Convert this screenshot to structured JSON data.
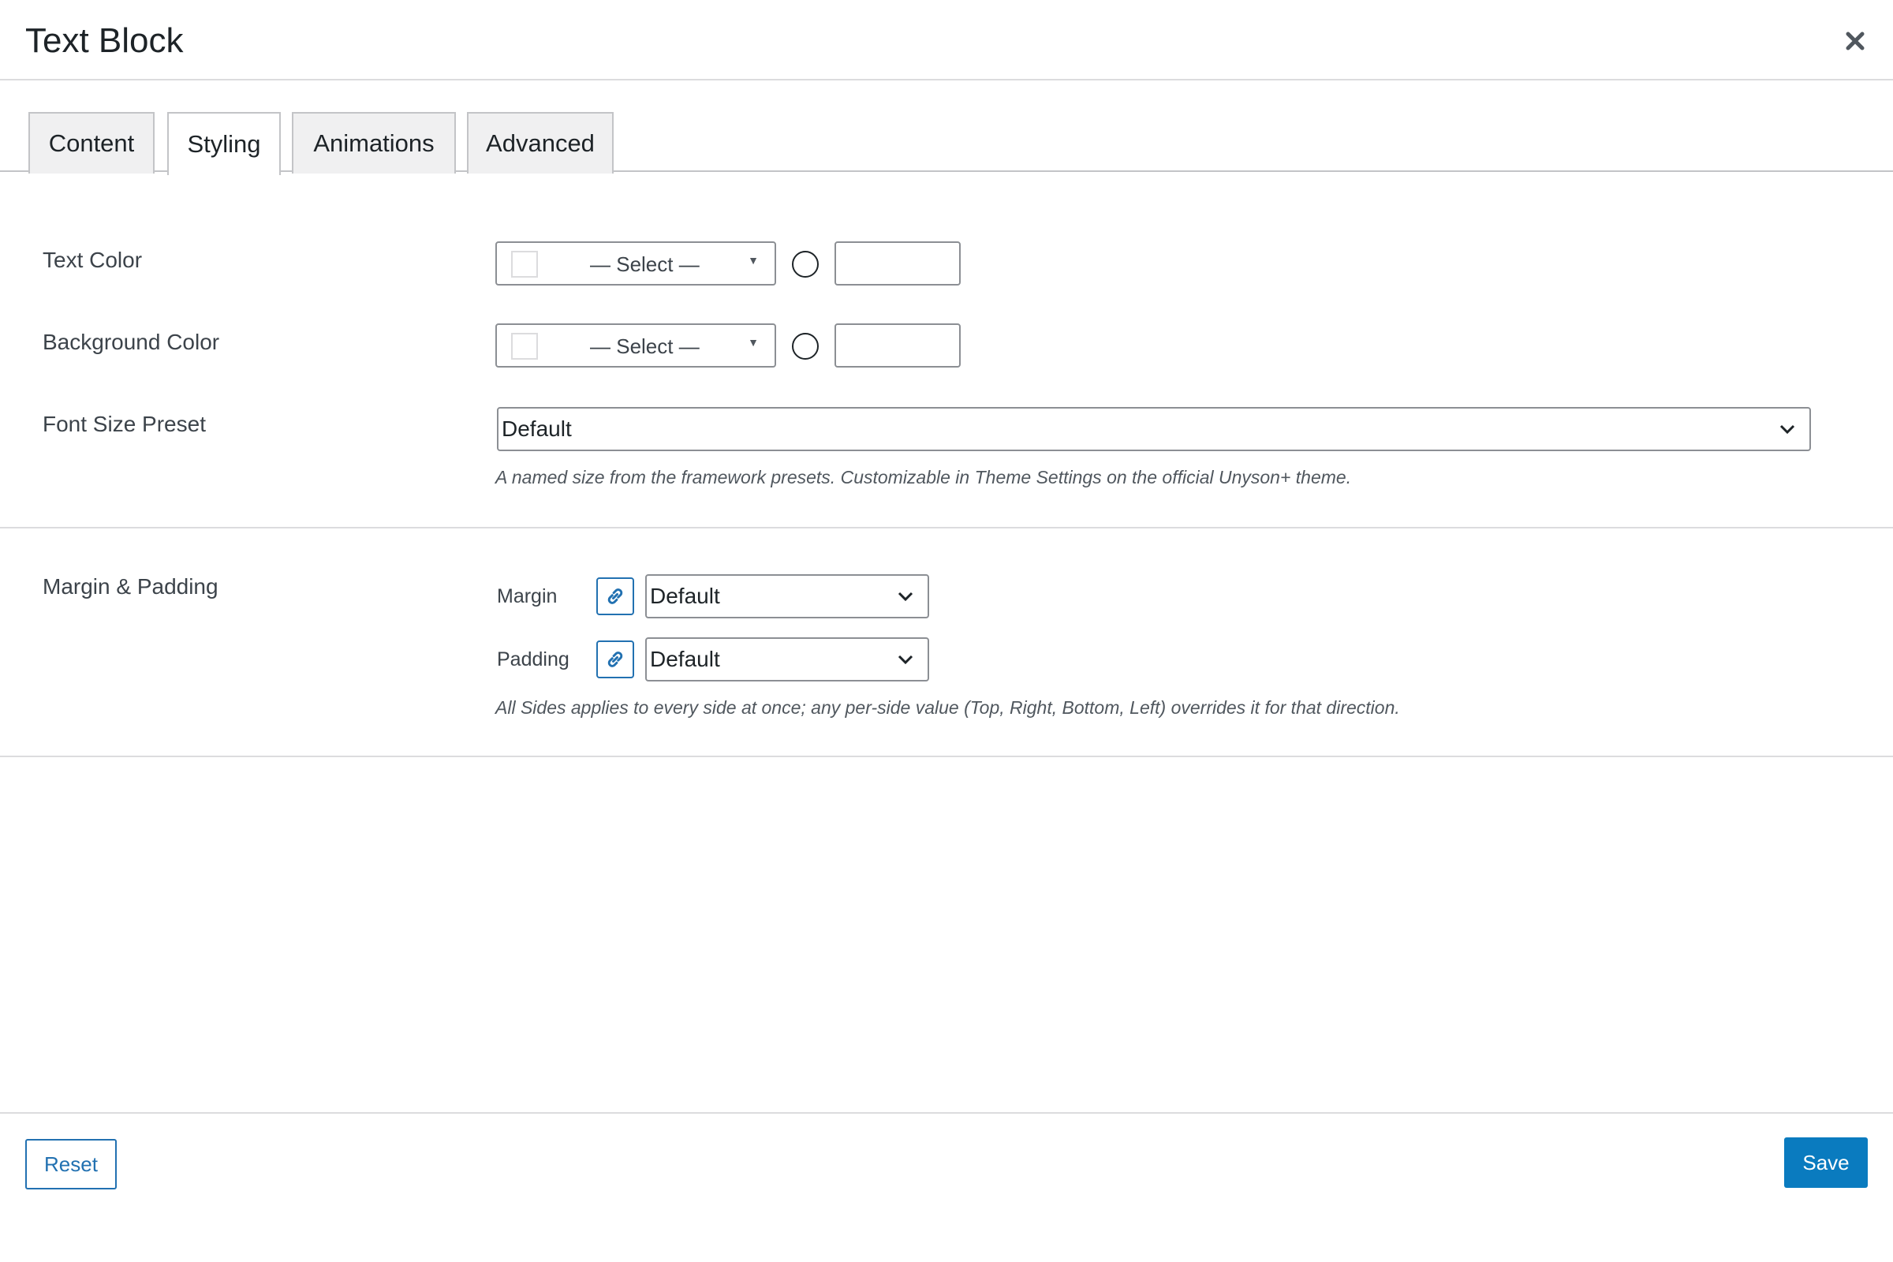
{
  "modal": {
    "title": "Text Block"
  },
  "tabs": [
    {
      "label": "Content",
      "active": false
    },
    {
      "label": "Styling",
      "active": true
    },
    {
      "label": "Animations",
      "active": false
    },
    {
      "label": "Advanced",
      "active": false
    }
  ],
  "styling": {
    "text_color": {
      "label": "Text Color",
      "select_value": "— Select —",
      "custom_value": ""
    },
    "background_color": {
      "label": "Background Color",
      "select_value": "— Select —",
      "custom_value": ""
    },
    "font_size_preset": {
      "label": "Font Size Preset",
      "value": "Default",
      "help": "A named size from the framework presets. Customizable in Theme Settings on the official Unyson+ theme."
    },
    "margin_padding": {
      "label": "Margin & Padding",
      "margin_label": "Margin",
      "margin_value": "Default",
      "padding_label": "Padding",
      "padding_value": "Default",
      "help": "All Sides applies to every side at once; any per-side value (Top, Right, Bottom, Left) overrides it for that direction."
    }
  },
  "footer": {
    "reset_label": "Reset",
    "save_label": "Save"
  },
  "icons": {
    "close": "close-icon",
    "link": "link-icon",
    "chevron": "chevron-down-icon"
  },
  "colors": {
    "accent": "#2271b1",
    "save_bg": "#0a7bbf",
    "border": "#8c8f94"
  }
}
